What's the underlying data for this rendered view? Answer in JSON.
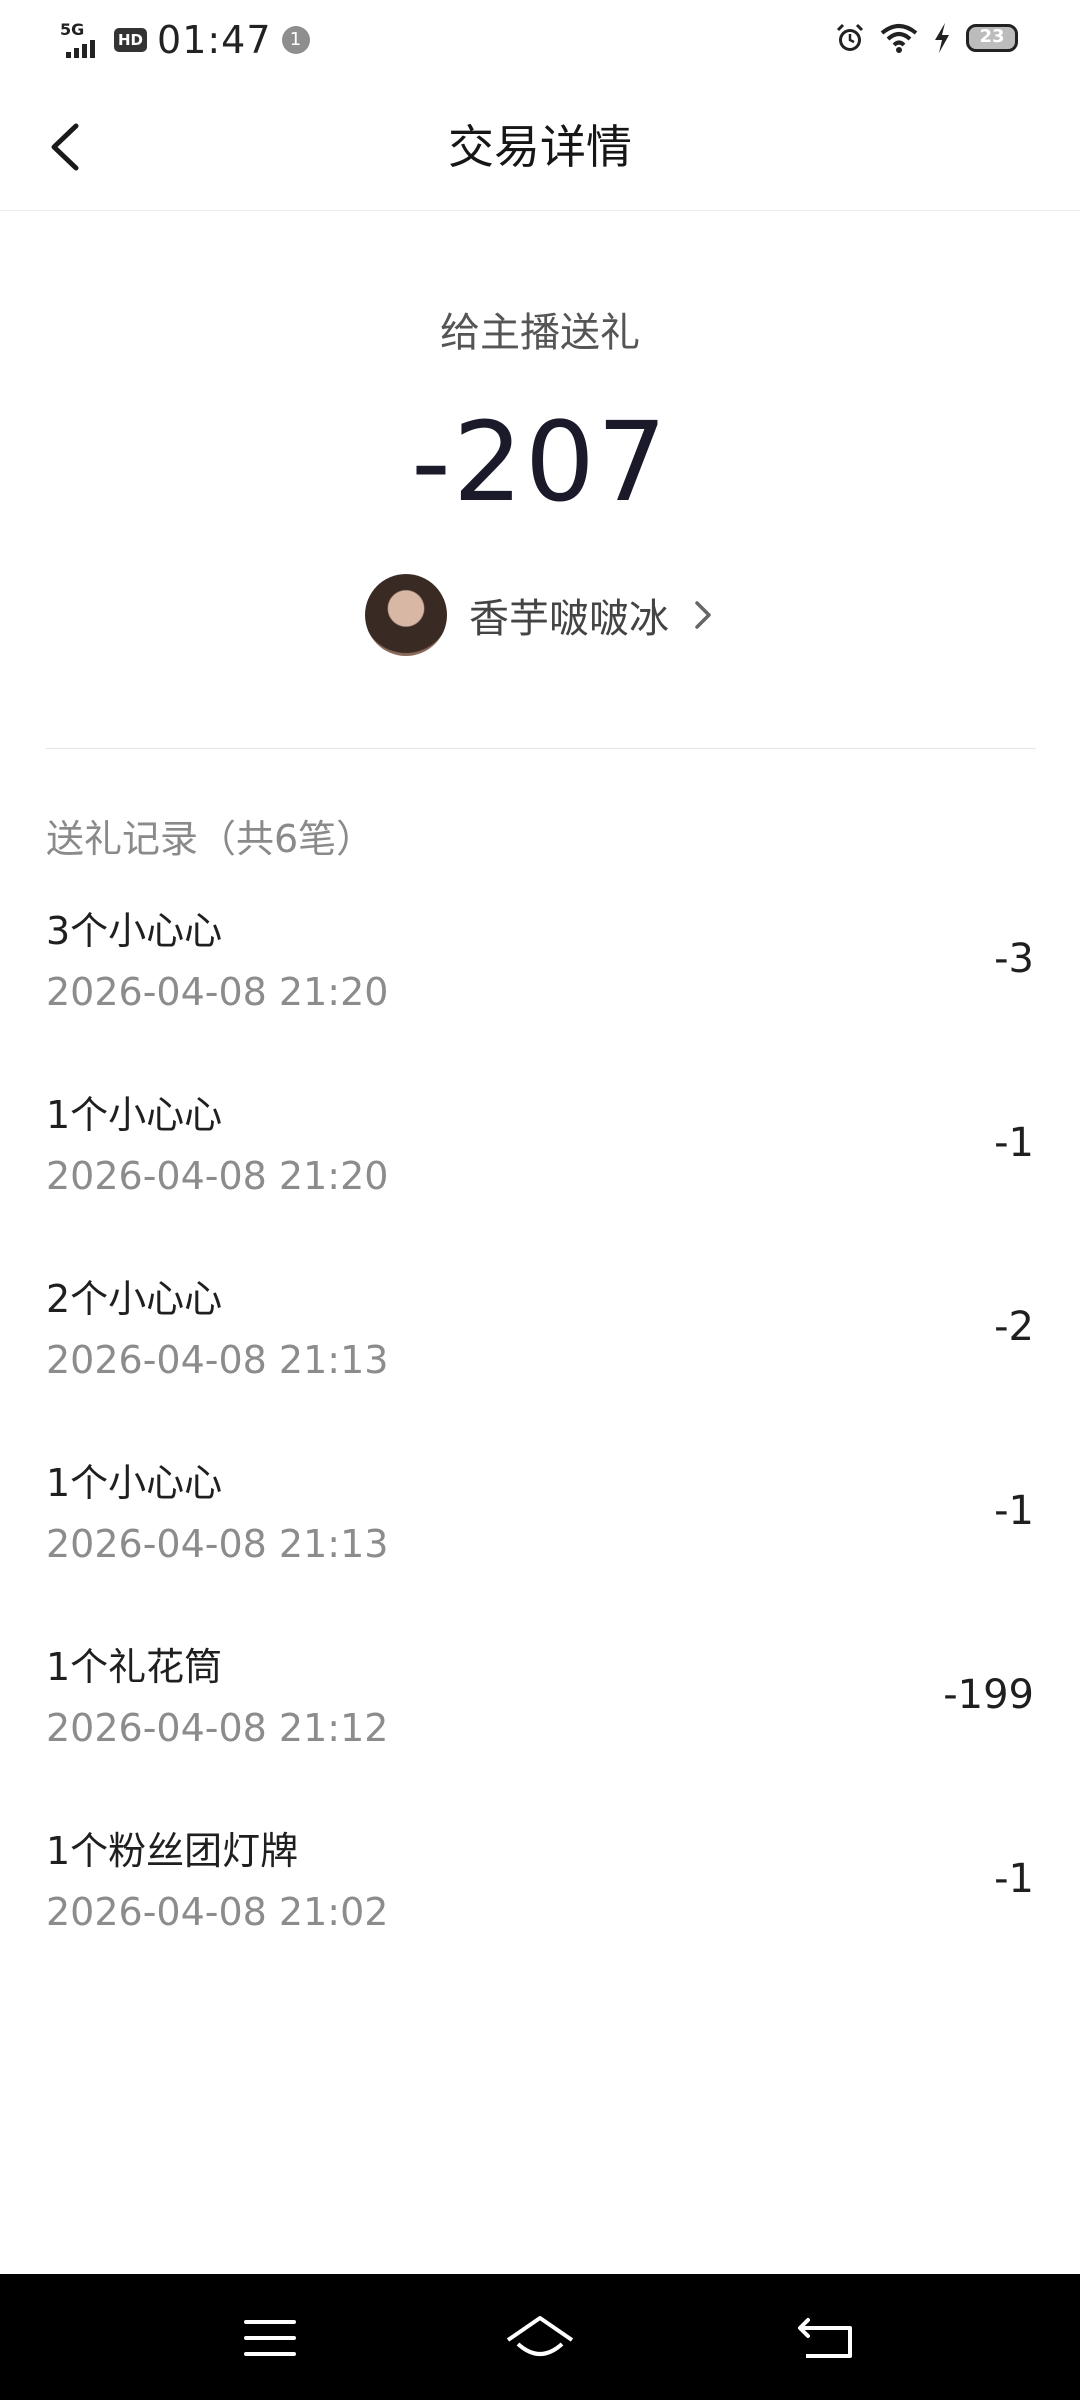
{
  "status_bar": {
    "network": "5G",
    "hd": "HD",
    "time": "01:47",
    "notification_count": "1",
    "battery": "23",
    "icons": [
      "alarm-icon",
      "wifi-icon",
      "charging-icon",
      "battery-icon"
    ]
  },
  "header": {
    "title": "交易详情",
    "back_icon": "back-icon"
  },
  "summary": {
    "type": "给主播送礼",
    "amount": "-207",
    "anchor_name": "香芋啵啵冰"
  },
  "records": {
    "title": "送礼记录（共6笔）",
    "items": [
      {
        "name": "3个小心心",
        "time": "2026-04-08 21:20",
        "value": "-3"
      },
      {
        "name": "1个小心心",
        "time": "2026-04-08 21:20",
        "value": "-1"
      },
      {
        "name": "2个小心心",
        "time": "2026-04-08 21:13",
        "value": "-2"
      },
      {
        "name": "1个小心心",
        "time": "2026-04-08 21:13",
        "value": "-1"
      },
      {
        "name": "1个礼花筒",
        "time": "2026-04-08 21:12",
        "value": "-199"
      },
      {
        "name": "1个粉丝团灯牌",
        "time": "2026-04-08 21:02",
        "value": "-1"
      }
    ]
  },
  "nav": {
    "icons": [
      "menu-icon",
      "home-icon",
      "back-nav-icon"
    ]
  }
}
